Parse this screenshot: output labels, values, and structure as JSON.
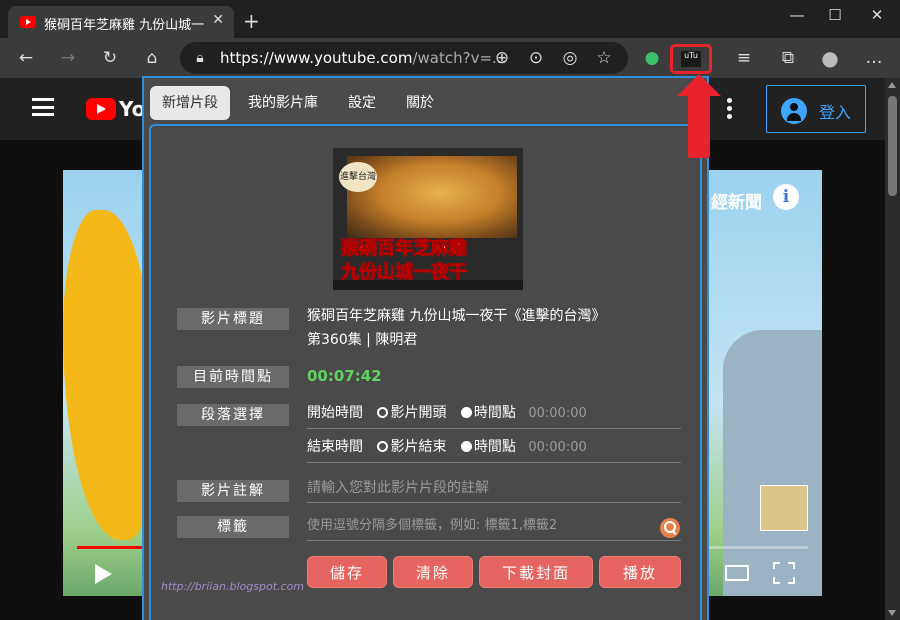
{
  "browser": {
    "tab_title": "猴硐百年芝麻雞 九份山城一夜干",
    "tab_close": "✕",
    "new_tab": "+",
    "minimize": "—",
    "maximize": "☐",
    "close": "✕",
    "url_main": "https://www.youtube.com",
    "url_rest": "/watch?v=...",
    "ext_badge": "uTu"
  },
  "youtube": {
    "logo_text": "You",
    "signin_label": "登入",
    "video_caption": "經新聞"
  },
  "popup": {
    "tabs": [
      "新增片段",
      "我的影片庫",
      "設定",
      "關於"
    ],
    "cover": {
      "logo": "進擊台灣",
      "line1": "猴硐百年芝麻雞",
      "line2": "九份山城一夜干"
    },
    "title_label": "影片標題",
    "title_line1": "猴硐百年芝麻雞 九份山城一夜干《進擊的台灣》",
    "title_line2": "第360集 | 陳明君",
    "time_label": "目前時間點",
    "current_time": "00:07:42",
    "segment_label": "段落選擇",
    "start_label": "開始時間",
    "start_opt1": "影片開頭",
    "start_opt2": "時間點",
    "start_time": "00:00:00",
    "end_label": "結束時間",
    "end_opt1": "影片結束",
    "end_opt2": "時間點",
    "end_time": "00:00:00",
    "note_label": "影片註解",
    "note_placeholder": "請輸入您對此影片片段的註解",
    "tags_label": "標籤",
    "tags_placeholder": "使用逗號分隔多個標籤，例如: 標籤1,標籤2",
    "buttons": [
      "儲存",
      "清除",
      "下載封面",
      "播放"
    ],
    "watermark": "http://briian.blogspot.com"
  },
  "video": {
    "progress_fraction": 0.11
  },
  "colors": {
    "accent_blue": "#2f8fd8",
    "button_red": "#e5645f",
    "time_green": "#5fd35f",
    "annotation_red": "#e8232b"
  }
}
